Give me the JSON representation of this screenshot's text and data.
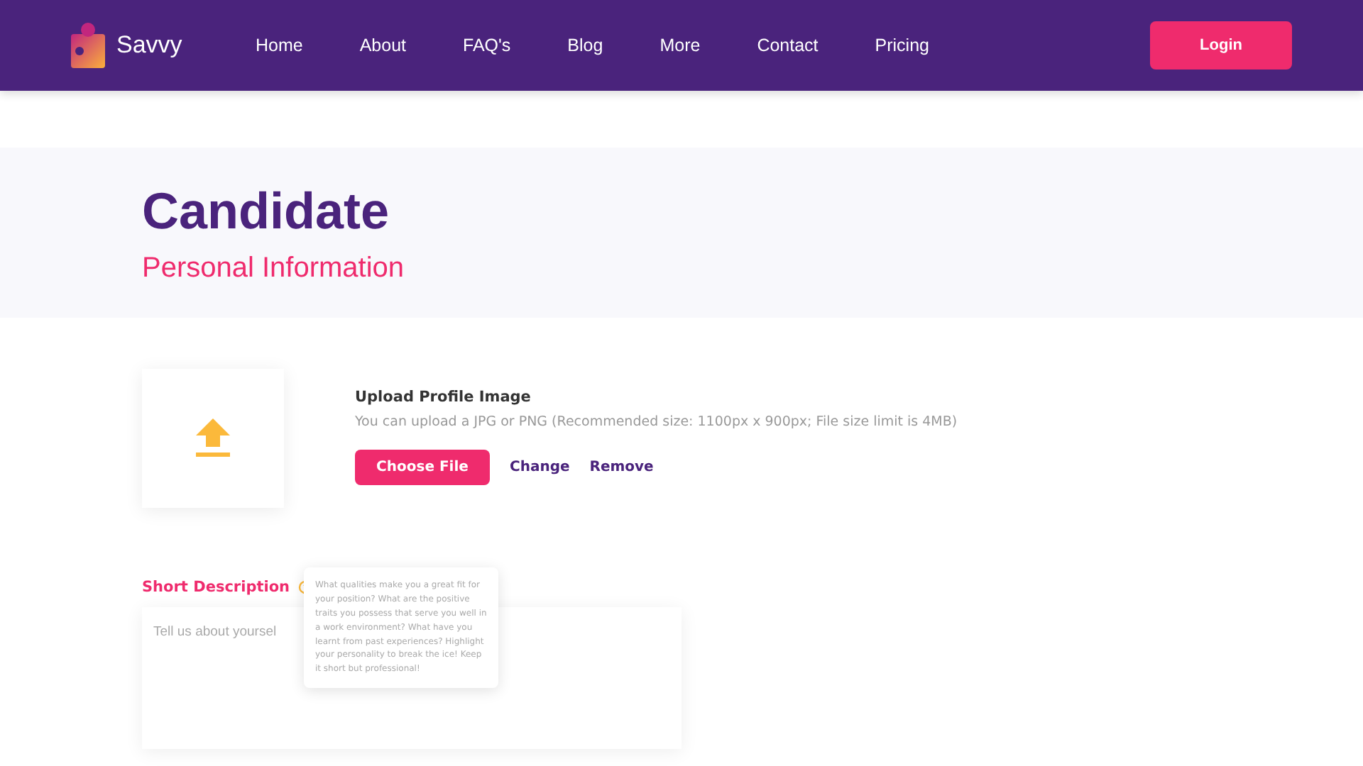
{
  "brand": {
    "name": "Savvy"
  },
  "nav": [
    {
      "label": "Home"
    },
    {
      "label": "About"
    },
    {
      "label": "FAQ's"
    },
    {
      "label": "Blog"
    },
    {
      "label": "More"
    },
    {
      "label": "Contact"
    },
    {
      "label": "Pricing"
    }
  ],
  "login": "Login",
  "header": {
    "title": "Candidate",
    "subtitle": "Personal Information"
  },
  "upload": {
    "title": "Upload Profile Image",
    "hint": "You can upload a JPG or PNG (Recommended size: 1100px x 900px; File size limit is 4MB)",
    "choose": "Choose File",
    "change": "Change",
    "remove": "Remove"
  },
  "description": {
    "label": "Short Description",
    "placeholder": "Tell us about yoursel",
    "tooltip": "What qualities make you a great fit for your position? What are the positive traits you possess that serve you well in a work environment? What have you learnt from past experiences? Highlight your personality to break the ice! Keep it short but professional!"
  }
}
